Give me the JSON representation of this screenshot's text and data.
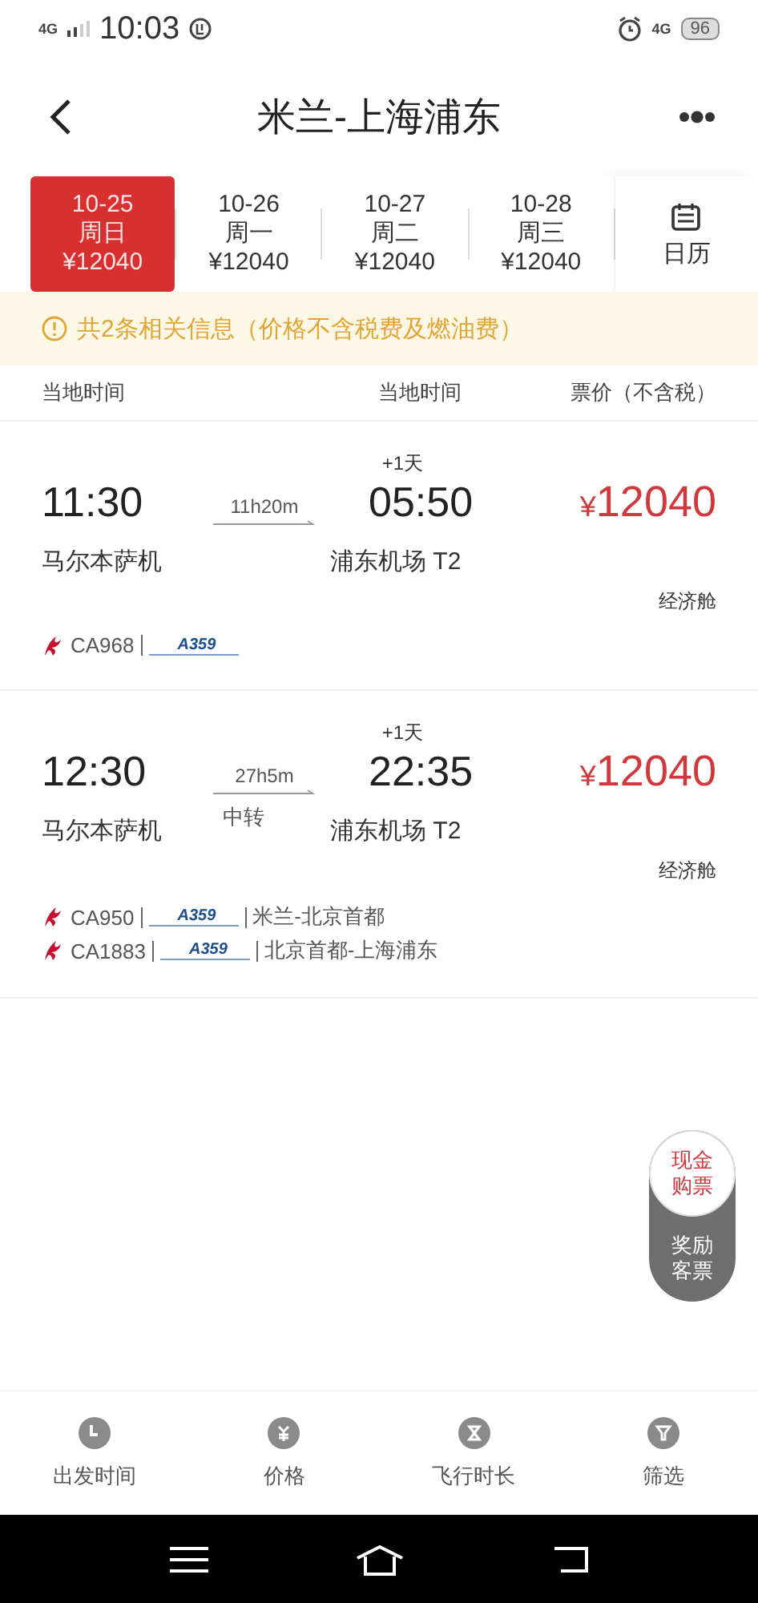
{
  "status_bar": {
    "network_left": "4G",
    "time": "10:03",
    "network_right": "4G",
    "battery": "96"
  },
  "header": {
    "title": "米兰-上海浦东"
  },
  "dates": [
    {
      "date": "10-25",
      "weekday": "周日",
      "price": "¥12040",
      "selected": true
    },
    {
      "date": "10-26",
      "weekday": "周一",
      "price": "¥12040",
      "selected": false
    },
    {
      "date": "10-27",
      "weekday": "周二",
      "price": "¥12040",
      "selected": false
    },
    {
      "date": "10-28",
      "weekday": "周三",
      "price": "¥12040",
      "selected": false
    }
  ],
  "calendar_label": "日历",
  "notice": "共2条相关信息（价格不含税费及燃油费）",
  "columns": [
    "当地时间",
    "当地时间",
    "票价（不含税）"
  ],
  "flights": [
    {
      "dep_time": "11:30",
      "duration": "11h20m",
      "arr_time": "05:50",
      "day_offset": "+1天",
      "dep_airport": "马尔本萨机",
      "arr_airport": "浦东机场 T2",
      "currency": "¥",
      "price": "12040",
      "cabin": "经济舱",
      "segments": [
        {
          "flight_no": "CA968",
          "aircraft": "A359"
        }
      ]
    },
    {
      "dep_time": "12:30",
      "duration": "27h5m",
      "transfer": "中转",
      "arr_time": "22:35",
      "day_offset": "+1天",
      "dep_airport": "马尔本萨机",
      "arr_airport": "浦东机场 T2",
      "currency": "¥",
      "price": "12040",
      "cabin": "经济舱",
      "segments": [
        {
          "flight_no": "CA950",
          "aircraft": "A359",
          "route": "米兰-北京首都"
        },
        {
          "flight_no": "CA1883",
          "aircraft": "A359",
          "route": "北京首都-上海浦东"
        }
      ]
    }
  ],
  "ticket_types": [
    {
      "label": "现金购票",
      "selected": true
    },
    {
      "label": "奖励客票",
      "selected": false
    }
  ],
  "bottom_tabs": [
    {
      "kind": "clock",
      "label": "出发时间"
    },
    {
      "kind": "yuan",
      "label": "价格"
    },
    {
      "kind": "hourglass",
      "label": "飞行时长"
    },
    {
      "kind": "filter",
      "label": "筛选"
    }
  ]
}
